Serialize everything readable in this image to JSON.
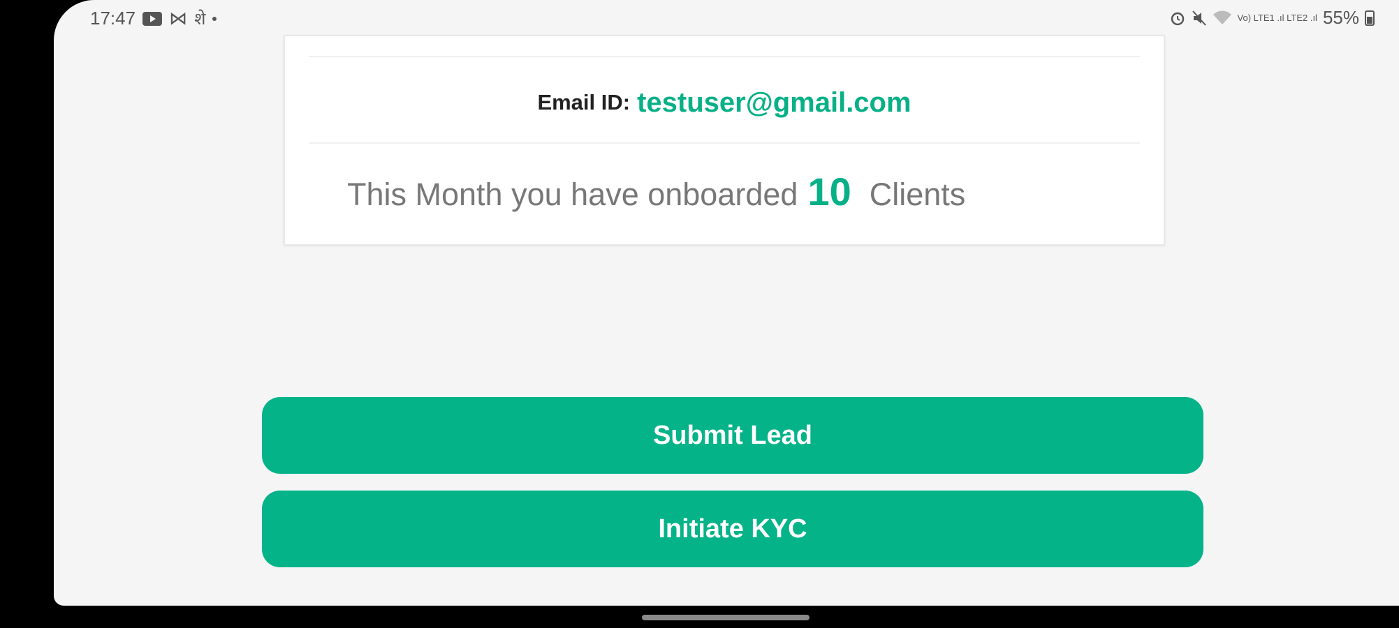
{
  "status_bar": {
    "time": "17:47",
    "nfc_glyph": "⋈",
    "lang_glyph": "शे",
    "signal_text": "Vo) LTE1 .ıl LTE2 .ıl",
    "battery": "55%",
    "icons": [
      "youtube-icon",
      "mail-icon",
      "language-icon",
      "notification-dot-icon",
      "alarm-icon",
      "mute-icon",
      "wifi-icon",
      "signal-icon",
      "battery-icon"
    ]
  },
  "profile_card": {
    "email_label": "Email ID:",
    "email_value": "testuser@gmail.com",
    "onboard_prefix": "This Month you have onboarded",
    "onboard_count": "10",
    "onboard_suffix": "Clients"
  },
  "actions": {
    "submit_lead_label": "Submit Lead",
    "initiate_kyc_label": "Initiate KYC"
  },
  "colors": {
    "accent": "#05b389",
    "background": "#f5f5f5"
  }
}
